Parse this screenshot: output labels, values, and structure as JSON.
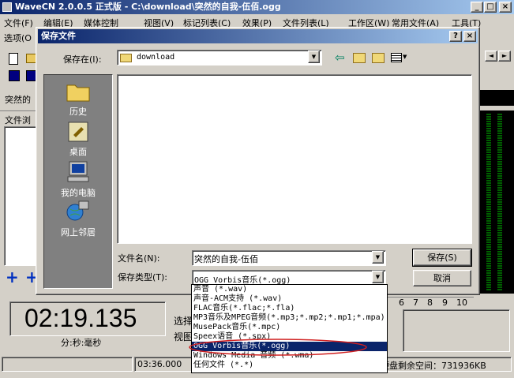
{
  "app": {
    "title": "WaveCN 2.0.0.5 正式版 - C:\\download\\突然的自我-伍佰.ogg",
    "menu": [
      "文件(F)",
      "编辑(E)",
      "媒体控制",
      "视图(V)",
      "标记列表(C)",
      "效果(P)",
      "文件列表(L)",
      "工作区(W)",
      "常用文件(A)",
      "工具(T)"
    ],
    "menu2": "选项(O",
    "tab_label": "突然的",
    "file_browser_label": "文件浏",
    "time_display": "02:19.135",
    "time_units": "分:秒:毫秒",
    "select_label": "选择",
    "view_label": "视图",
    "status_duration": "03:36.000",
    "status_disk": "硬盘剩余空间：731936KB",
    "ruler_numbers": [
      "6",
      "7",
      "8",
      "9",
      "10"
    ],
    "window_controls": [
      "_",
      "□",
      "×"
    ],
    "scroll_arrows": [
      "◄",
      "►"
    ]
  },
  "dialog": {
    "title": "保存文件",
    "title_buttons": [
      "?",
      "×"
    ],
    "save_in_label": "保存在(I):",
    "save_in_value": "download",
    "places": [
      "历史",
      "桌面",
      "我的电脑",
      "网上邻居"
    ],
    "filename_label": "文件名(N):",
    "filename_value": "突然的自我-伍佰",
    "filetype_label": "保存类型(T):",
    "filetype_value": "OGG Vorbis音乐(*.ogg)",
    "save_button": "保存(S)",
    "cancel_button": "取消",
    "filetype_options": [
      "声音 (*.wav)",
      "声音-ACM支持 (*.wav)",
      "FLAC音乐(*.flac;*.fla)",
      "MP3音乐及MPEG音频(*.mp3;*.mp2;*.mp1;*.mpa)",
      "MusePack音乐(*.mpc)",
      "Speex语音 (*.spx)",
      "OGG Vorbis音乐(*.ogg)",
      "Windows Media 音频 (*.wma)",
      "任何文件 (*.*)"
    ],
    "selected_option_index": 6
  }
}
